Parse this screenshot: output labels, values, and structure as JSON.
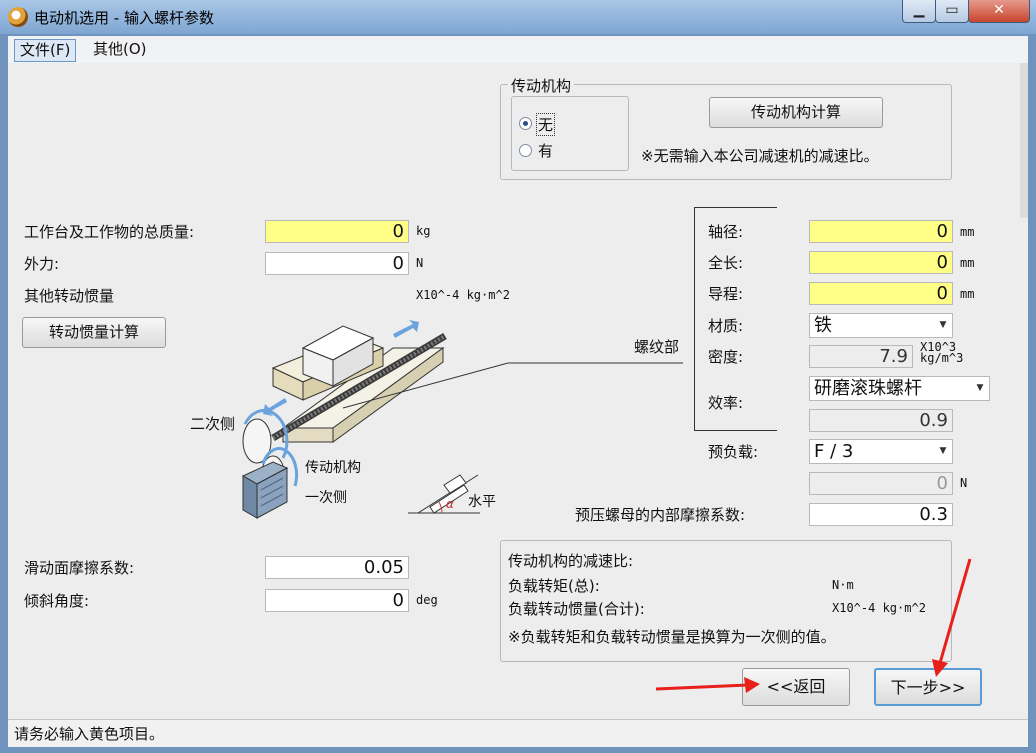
{
  "window": {
    "title": "电动机选用 - 输入螺杆参数",
    "minimize": "▁",
    "maximize": "▭",
    "close": "✕"
  },
  "menu": [
    "文件(F)",
    "其他(O)"
  ],
  "transmission": {
    "group_title": "传动机构",
    "option_none": "无",
    "option_yes": "有",
    "selected": "无",
    "calc_button": "传动机构计算",
    "note": "※无需输入本公司减速机的减速比。"
  },
  "left": {
    "total_mass_label": "工作台及工作物的总质量:",
    "total_mass_value": "0",
    "total_mass_unit": "kg",
    "external_force_label": "外力:",
    "external_force_value": "0",
    "external_force_unit": "N",
    "other_inertia_label": "其他转动惯量",
    "other_inertia_unit": "X10^-4 kg·m^2",
    "inertia_calc_button": "转动惯量计算",
    "friction_label": "滑动面摩擦系数:",
    "friction_value": "0.05",
    "incline_label": "倾斜角度:",
    "incline_value": "0",
    "incline_unit": "deg"
  },
  "diagram": {
    "screw_part": "螺纹部",
    "secondary_side": "二次侧",
    "transmission": "传动机构",
    "primary_side": "一次侧",
    "horizontal": "水平",
    "alpha": "α"
  },
  "screw": {
    "shaft_diameter_label": "轴径:",
    "shaft_diameter_value": "0",
    "shaft_diameter_unit": "mm",
    "length_label": "全长:",
    "length_value": "0",
    "length_unit": "mm",
    "lead_label": "导程:",
    "lead_value": "0",
    "lead_unit": "mm",
    "material_label": "材质:",
    "material_value": "铁",
    "density_label": "密度:",
    "density_value": "7.9",
    "density_unit_1": "X10^3",
    "density_unit_2": "kg/m^3",
    "efficiency_label": "效率:",
    "efficiency_type": "研磨滚珠螺杆",
    "efficiency_value": "0.9",
    "preload_label": "预负载:",
    "preload_value": "F / 3",
    "preload_force_value": "0",
    "preload_force_unit": "N",
    "nut_friction_label": "预压螺母的内部摩擦系数:",
    "nut_friction_value": "0.3"
  },
  "results": {
    "ratio_label": "传动机构的减速比:",
    "torque_label": "负载转矩(总):",
    "torque_unit": "N·m",
    "inertia_label": "负载转动惯量(合计):",
    "inertia_unit": "X10^-4 kg·m^2",
    "note": "※负载转矩和负载转动惯量是换算为一次侧的值。"
  },
  "nav": {
    "back_button": "<<返回",
    "next_button": "下一步>>"
  },
  "status": "请务必输入黄色项目。",
  "colors": {
    "required_field": "#ffff88",
    "annotation_arrow": "#e8201a",
    "title_bar": "#8fb3dc"
  }
}
